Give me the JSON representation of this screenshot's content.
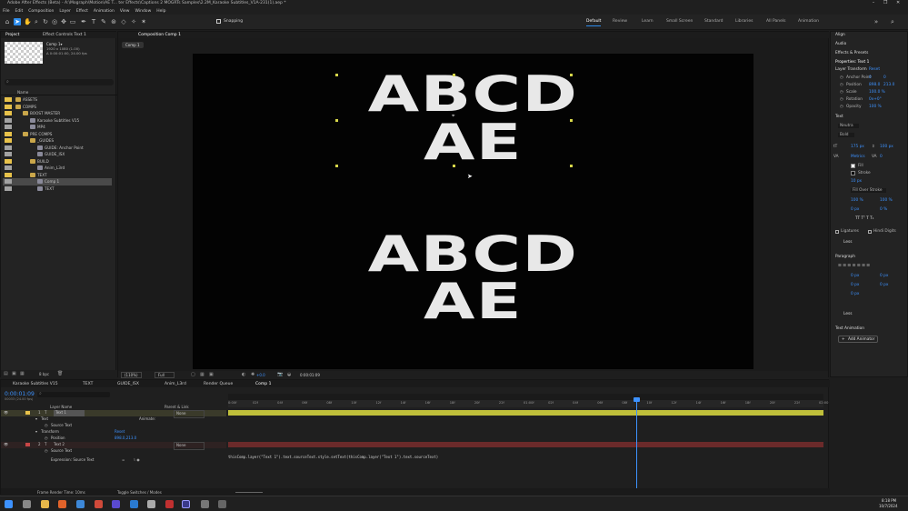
{
  "window": {
    "title": "Adobe After Effects (Beta) - A:\\Mograph\\Motion\\AE T... ter Effects\\Captions 2 MOGRTs Samples\\2.2M_Karaoke Subtitles_V1A-231(1).aep *",
    "controls": [
      "–",
      "❐",
      "✕"
    ]
  },
  "menu": [
    "File",
    "Edit",
    "Composition",
    "Layer",
    "Effect",
    "Animation",
    "View",
    "Window",
    "Help"
  ],
  "toolbar": {
    "snapping_label": "Snapping",
    "workspaces": [
      "Default",
      "Review",
      "Learn",
      "Small Screen",
      "Standard",
      "Libraries",
      "All Panels",
      "Animation"
    ],
    "active_workspace": "Default"
  },
  "project_panel": {
    "tabs": [
      "Project",
      "Effect Controls Text 1"
    ],
    "comp_name": "Comp 1▾",
    "comp_info": "1920 x 1080 (1.00)",
    "comp_duration": "Δ 0:00:01:00, 24.00 fps",
    "search_placeholder": "",
    "column_name": "Name",
    "tree": [
      {
        "depth": 0,
        "name": "ASSETS",
        "type": "folder",
        "label_color": "#e8c24a"
      },
      {
        "depth": 0,
        "name": "COMPS",
        "type": "folder",
        "label_color": "#e8c24a"
      },
      {
        "depth": 1,
        "name": "BOOST MASTER",
        "type": "folder",
        "label_color": "#e8c24a"
      },
      {
        "depth": 2,
        "name": "Karaoke Subtitles V15",
        "type": "comp",
        "label_color": "#a2a2a2"
      },
      {
        "depth": 2,
        "name": "MP4",
        "type": "comp",
        "label_color": "#a2a2a2"
      },
      {
        "depth": 1,
        "name": "PRE COMPS",
        "type": "folder",
        "label_color": "#e8c24a"
      },
      {
        "depth": 2,
        "name": "_GUIDES",
        "type": "folder",
        "label_color": "#e8c24a"
      },
      {
        "depth": 3,
        "name": "GUIDE: Anchor Point",
        "type": "comp",
        "label_color": "#a2a2a2"
      },
      {
        "depth": 3,
        "name": "GUIDE_ISX",
        "type": "comp",
        "label_color": "#a2a2a2"
      },
      {
        "depth": 2,
        "name": "BUILD",
        "type": "folder",
        "label_color": "#e8c24a"
      },
      {
        "depth": 3,
        "name": "Anim_L3rd",
        "type": "comp",
        "label_color": "#a2a2a2"
      },
      {
        "depth": 2,
        "name": "TEXT",
        "type": "folder",
        "label_color": "#e8c24a"
      },
      {
        "depth": 3,
        "name": "Comp 1",
        "type": "comp",
        "label_color": "#a2a2a2",
        "selected": true
      },
      {
        "depth": 3,
        "name": "TEXT",
        "type": "comp",
        "label_color": "#a2a2a2"
      }
    ],
    "bpc": "8 bpc"
  },
  "composition_panel": {
    "tab": "Composition Comp 1",
    "breadcrumb": "Comp 1",
    "canvas_text": [
      "ABCD",
      "AE"
    ],
    "canvas_text_bottom": [
      "ABCD",
      "AE"
    ],
    "footer": {
      "zoom": "(110%)",
      "resolution": "Full",
      "exposure": "+0.0",
      "time": "0:00:01:09"
    }
  },
  "right_panel": {
    "sections": [
      "Align",
      "Audio",
      "Effects & Presets"
    ],
    "properties_title": "Properties: Text 1",
    "layer_transform": "Layer Transform",
    "reset": "Reset",
    "transform": [
      {
        "label": "Anchor Point",
        "value": "0",
        "value2": "0"
      },
      {
        "label": "Position",
        "value": "898.0",
        "value2": "213.0"
      },
      {
        "label": "Scale",
        "value": "100.0 %",
        "value2": ""
      },
      {
        "label": "Rotation",
        "value": "0x+0°",
        "value2": ""
      },
      {
        "label": "Opacity",
        "value": "100 %",
        "value2": ""
      }
    ],
    "text_section": "Text",
    "font": "Neutra",
    "font_style": "Bold",
    "font_size": "175 px",
    "leading": "100 px",
    "kerning": "Metrics",
    "tracking": "0",
    "fill_label": "Fill",
    "stroke_label": "Stroke",
    "stroke_width": "10 px",
    "stroke_mode": "Fill Over Stroke",
    "vscale": "100 %",
    "hscale": "100 %",
    "baseline": "0 px",
    "tsume": "0 %",
    "ligatures": "Ligatures",
    "hindi_digits": "Hindi Digits",
    "less": "Less",
    "paragraph": "Paragraph",
    "para_values": [
      "0 px",
      "0 px",
      "0 px",
      "0 px",
      "0 px"
    ],
    "less2": "Less",
    "text_animation": "Text Animation",
    "add_animator": "Add Animator"
  },
  "timeline": {
    "tabs": [
      "Karaoke Subtitles V15",
      "TEXT",
      "GUIDE_ISX",
      "Anim_L3rd",
      "Render Queue",
      "Comp 1"
    ],
    "active_tab": "Comp 1",
    "timecode": "0:00:01:09",
    "frame_info": "00033 (24.00 fps)",
    "columns": {
      "layer_name": "Layer Name",
      "parent": "Parent & Link"
    },
    "rows": [
      {
        "num": "1",
        "name": "Text 1",
        "parent": "None",
        "kind": "layer"
      },
      {
        "name": "Text",
        "kind": "group",
        "extra": "Animate:"
      },
      {
        "name": "Source Text",
        "kind": "prop"
      },
      {
        "name": "Transform",
        "kind": "group",
        "extra": "Reset"
      },
      {
        "name": "Position",
        "kind": "prop",
        "value": "898.0,213.0"
      },
      {
        "num": "2",
        "name": "Text 2",
        "parent": "None",
        "kind": "layer"
      },
      {
        "name": "Source Text",
        "kind": "prop"
      },
      {
        "name": "Expression: Source Text",
        "kind": "prop"
      }
    ],
    "expression": "thisComp.layer(\"Text 1\").text.sourceText.style.setText(thisComp.layer(\"Text 1\").text.sourceText)",
    "ruler": [
      "0:00f",
      "02f",
      "04f",
      "06f",
      "08f",
      "10f",
      "12f",
      "14f",
      "16f",
      "18f",
      "20f",
      "22f",
      "01:00f",
      "02f",
      "04f",
      "06f",
      "08f",
      "10f",
      "12f",
      "14f",
      "16f",
      "18f",
      "20f",
      "22f",
      "02:00"
    ],
    "footer_left": "Frame Render Time: 10ms",
    "footer_mid": "Toggle Switches / Modes"
  },
  "taskbar": {
    "time": "8:18 PM",
    "date": "10/7/2024"
  }
}
